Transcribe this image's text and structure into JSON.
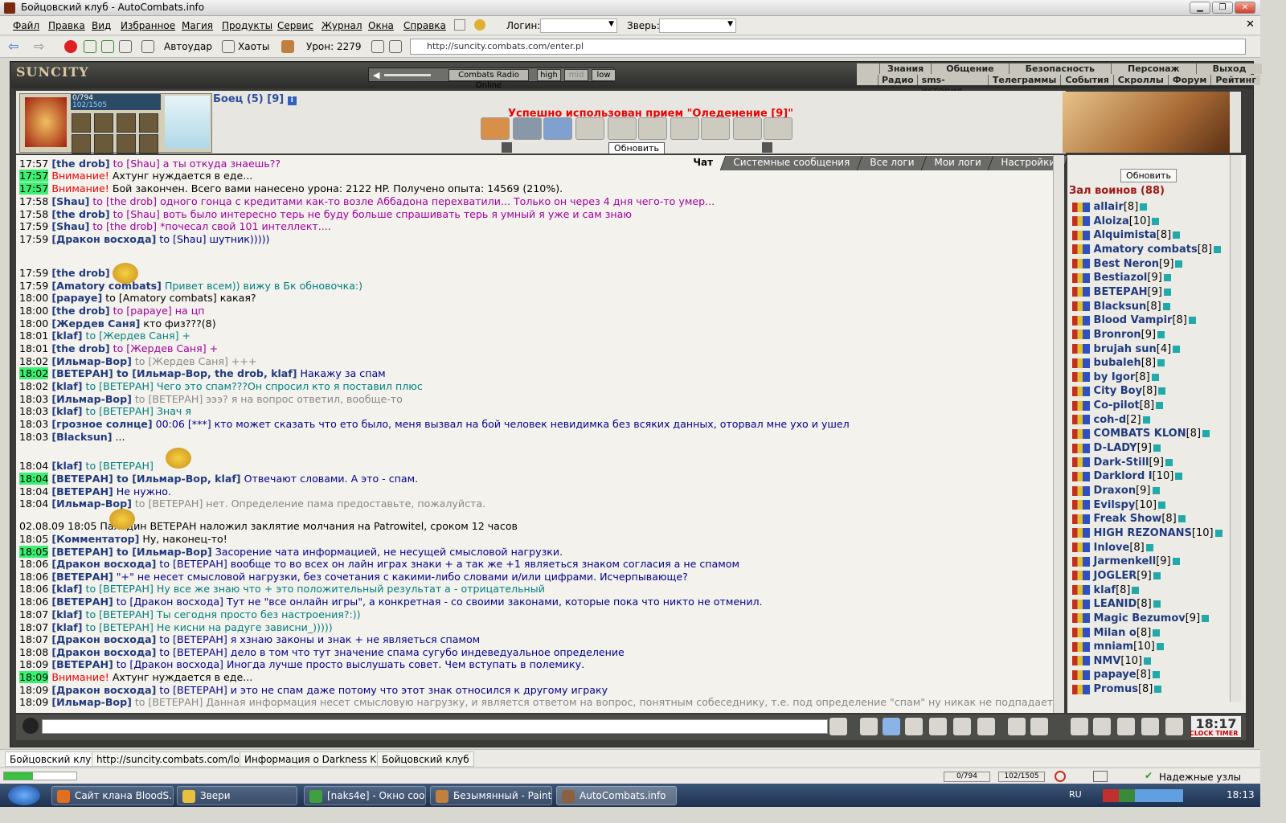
{
  "window": {
    "title": "Бойцовский клуб - AutoCombats.info"
  },
  "menu": [
    "Файл",
    "Правка",
    "Вид",
    "Избранное",
    "Магия",
    "Продукты",
    "Сервис",
    "Журнал",
    "Окна",
    "Справка"
  ],
  "login_label": "Логин:",
  "beast_label": "Зверь:",
  "toolbar": {
    "autoattack": "Автоудар",
    "chaos": "Хаоты",
    "damage": "Урон: 2279",
    "address": "http://suncity.combats.com/enter.pl"
  },
  "game": {
    "logo": "SUNCITY",
    "radio": {
      "station": "Combats Radio Online",
      "high": "high",
      "mid": "mid",
      "low": "low"
    },
    "nav_top": [
      "Знания",
      "Общение",
      "Безопасность",
      "Персонаж",
      "Выход"
    ],
    "nav_bottom": [
      "Радио",
      "sms-история",
      "Телеграммы",
      "События",
      "Скроллы",
      "Форум",
      "Рейтинг"
    ],
    "hp": "0/794",
    "mana": "102/1505",
    "fighter": "Боец (5) [9]",
    "message": "Успешно использован прием \"Оледенение [9]\"",
    "refresh": "Обновить"
  },
  "chat_tabs": [
    "Чат",
    "Системные сообщения",
    "Все логи",
    "Мои логи",
    "Настройки"
  ],
  "chat": [
    {
      "t": "17:57",
      "h": false,
      "n": "[the drob]",
      "to": " to [Shau]",
      "tc": "to",
      "m": " а ты откуда знаешь??",
      "mc": "to"
    },
    {
      "t": "17:57",
      "h": true,
      "n": "",
      "to": "Внимание!",
      "tc": "red",
      "m": " Ахтунг нуждается в еде...",
      "mc": "tm"
    },
    {
      "t": "17:57",
      "h": true,
      "n": "",
      "to": "Внимание!",
      "tc": "red",
      "m": " Бой закончен. Всего вами нанесено урона: 2122 HP. Получено опыта: 14569 (210%).",
      "mc": "tm"
    },
    {
      "t": "17:58",
      "h": false,
      "n": "[Shau]",
      "to": " to [the drob]",
      "tc": "to",
      "m": " одного гонца с кредитами как-то возле Аббадона перехватили... Только он через 4 дня чего-то умер...",
      "mc": "to"
    },
    {
      "t": "17:58",
      "h": false,
      "n": "[the drob]",
      "to": " to [Shau]",
      "tc": "to",
      "m": " воть было интересно терь не буду больше спрашивать терь я умный я уже и сам знаю",
      "mc": "to"
    },
    {
      "t": "17:59",
      "h": false,
      "n": "[Shau]",
      "to": " to [the drob]",
      "tc": "to",
      "m": " *почесал свой 101 интеллект....",
      "mc": "to"
    },
    {
      "t": "17:59",
      "h": false,
      "n": "[Дракон восхода]",
      "to": " to [Shau]",
      "tc": "tob",
      "m": " шутник)))))",
      "mc": "tob"
    },
    {
      "t": "17:59",
      "h": false,
      "n": "[the drob]",
      "to": "",
      "tc": "to",
      "m": "",
      "mc": "to"
    },
    {
      "t": "17:59",
      "h": false,
      "n": "[Amatory combats]",
      "to": "",
      "tc": "tot",
      "m": " Привет всем)) вижу в Бк обновочка:)",
      "mc": "tot"
    },
    {
      "t": "18:00",
      "h": false,
      "n": "[papaye]",
      "to": " to [Amatory combats]",
      "tc": "tm",
      "m": " какая?",
      "mc": "tm"
    },
    {
      "t": "18:00",
      "h": false,
      "n": "[the drob]",
      "to": " to [papaye]",
      "tc": "to",
      "m": " на цп",
      "mc": "to"
    },
    {
      "t": "18:00",
      "h": false,
      "n": "[Жердев Саня]",
      "to": "",
      "tc": "tm",
      "m": " кто физ???(8)",
      "mc": "tm"
    },
    {
      "t": "18:01",
      "h": false,
      "n": "[klaf]",
      "to": " to [Жердев Саня]",
      "tc": "tot",
      "m": " +",
      "mc": "tot"
    },
    {
      "t": "18:01",
      "h": false,
      "n": "[the drob]",
      "to": " to [Жердев Саня]",
      "tc": "to",
      "m": " +",
      "mc": "to"
    },
    {
      "t": "18:02",
      "h": false,
      "n": "[Ильмар-Вор]",
      "to": " to [Жердев Саня]",
      "tc": "tog",
      "m": " +++",
      "mc": "tog"
    },
    {
      "t": "18:02",
      "h": true,
      "n": "[ВЕТЕРАН]",
      "to": " to [Ильмар-Вор, the drob, klaf]",
      "tc": "nk",
      "m": " Накажу за спам",
      "mc": "tob"
    },
    {
      "t": "18:02",
      "h": false,
      "n": "[klaf]",
      "to": " to [ВЕТЕРАН]",
      "tc": "tot",
      "m": " Чего это спам???Он спросил кто я поставил плюс",
      "mc": "tot"
    },
    {
      "t": "18:03",
      "h": false,
      "n": "[Ильмар-Вор]",
      "to": " to [ВЕТЕРАН]",
      "tc": "tog",
      "m": " эээ? я на вопрос ответил, вообще-то",
      "mc": "tog"
    },
    {
      "t": "18:03",
      "h": false,
      "n": "[klaf]",
      "to": " to [ВЕТЕРАН]",
      "tc": "tot",
      "m": " Знач я",
      "mc": "tot"
    },
    {
      "t": "18:03",
      "h": false,
      "n": "[грозное солнце]",
      "to": " 00:06 [***]",
      "tc": "tob",
      "m": " кто может сказать что ето было, меня вызвал на бой человек невидимка без всяких данных, оторвал мне ухо и ушел",
      "mc": "tob"
    },
    {
      "t": "18:03",
      "h": false,
      "n": "[Blacksun]",
      "to": "",
      "tc": "tm",
      "m": " ...",
      "mc": "tm"
    },
    {
      "t": "18:04",
      "h": false,
      "n": "[klaf]",
      "to": " to [ВЕТЕРАН]",
      "tc": "tot",
      "m": "",
      "mc": "tot"
    },
    {
      "t": "18:04",
      "h": true,
      "n": "[ВЕТЕРАН]",
      "to": " to [Ильмар-Вор, klaf]",
      "tc": "nk",
      "m": " Отвечают словами. А это - спам.",
      "mc": "tob"
    },
    {
      "t": "18:04",
      "h": false,
      "n": "[ВЕТЕРАН]",
      "to": "",
      "tc": "tob",
      "m": " Не нужно.",
      "mc": "tob"
    },
    {
      "t": "18:04",
      "h": false,
      "n": "[Ильмар-Вор]",
      "to": " to [ВЕТЕРАН]",
      "tc": "tog",
      "m": " нет. Определение пама предоставьте, пожалуйста.",
      "mc": "tog"
    },
    {
      "t": "02.08.09 18:05",
      "h": false,
      "n": "",
      "to": "",
      "tc": "tm",
      "m": "Паладин ВЕТЕРАН наложил заклятие молчания на Patrowitel, сроком 12 часов",
      "mc": "tm"
    },
    {
      "t": "18:05",
      "h": false,
      "n": "[Комментатор]",
      "to": "",
      "tc": "tm",
      "m": " Ну, наконец-то!",
      "mc": "tm"
    },
    {
      "t": "18:05",
      "h": true,
      "n": "[ВЕТЕРАН]",
      "to": " to [Ильмар-Вор]",
      "tc": "nk",
      "m": " Засорение чата информацией, не несущей смысловой нагрузки.",
      "mc": "tob"
    },
    {
      "t": "18:06",
      "h": false,
      "n": "[Дракон восхода]",
      "to": " to [ВЕТЕРАН]",
      "tc": "tob",
      "m": " вообще то во всех он лайн играх знаки + а так же +1 являеться знаком согласия а не спамом",
      "mc": "tob"
    },
    {
      "t": "18:06",
      "h": false,
      "n": "[ВЕТЕРАН]",
      "to": "",
      "tc": "tob",
      "m": " \"+\" не несет смысловой нагрузки, без сочетания с какими-либо словами и/или цифрами. Исчерпывающе?",
      "mc": "tob"
    },
    {
      "t": "18:06",
      "h": false,
      "n": "[klaf]",
      "to": " to [ВЕТЕРАН]",
      "tc": "tot",
      "m": " Ну все же знаю что + это положительный результат а - отрицательный",
      "mc": "tot"
    },
    {
      "t": "18:06",
      "h": false,
      "n": "[ВЕТЕРАН]",
      "to": " to [Дракон восхода]",
      "tc": "tob",
      "m": " Тут не \"все онлайн игры\", а конкретная - со своими законами, которые пока что никто не отменил.",
      "mc": "tob"
    },
    {
      "t": "18:07",
      "h": false,
      "n": "[klaf]",
      "to": " to [ВЕТЕРАН]",
      "tc": "tot",
      "m": " Ты сегодня просто без настроения?:))",
      "mc": "tot"
    },
    {
      "t": "18:07",
      "h": false,
      "n": "[klaf]",
      "to": " to [ВЕТЕРАН]",
      "tc": "tot",
      "m": " Не кисни на радуге зависни_)))))",
      "mc": "tot"
    },
    {
      "t": "18:07",
      "h": false,
      "n": "[Дракон восхода]",
      "to": " to [ВЕТЕРАН]",
      "tc": "tob",
      "m": " я хзнаю законы и знак + не являеться спамом",
      "mc": "tob"
    },
    {
      "t": "18:08",
      "h": false,
      "n": "[Дракон восхода]",
      "to": " to [ВЕТЕРАН]",
      "tc": "tob",
      "m": " дело в том что тут значение спама сугубо индеведуальное определение",
      "mc": "tob"
    },
    {
      "t": "18:09",
      "h": false,
      "n": "[ВЕТЕРАН]",
      "to": " to [Дракон восхода]",
      "tc": "tob",
      "m": " Иногда лучше просто выслушать совет. Чем вступать в полемику.",
      "mc": "tob"
    },
    {
      "t": "18:09",
      "h": true,
      "n": "",
      "to": "Внимание!",
      "tc": "red",
      "m": " Ахтунг нуждается в еде...",
      "mc": "tm"
    },
    {
      "t": "18:09",
      "h": false,
      "n": "[Дракон восхода]",
      "to": " to [ВЕТЕРАН]",
      "tc": "tob",
      "m": " и это не спам даже потому что этот знак относился к другому играку",
      "mc": "tob"
    },
    {
      "t": "18:09",
      "h": false,
      "n": "[Ильмар-Вор]",
      "to": " to [ВЕТЕРАН]",
      "tc": "tog",
      "m": " Данная информация несет смысловую нагрузку, и является ответом на вопрос, понятным собеседнику, т.е. под определение \"спам\" ну никак не подпадает.",
      "mc": "tog"
    }
  ],
  "side": {
    "refresh": "Обновить",
    "hall_title": "Зал воинов (88)",
    "players": [
      {
        "n": "allair",
        "l": "[8]"
      },
      {
        "n": "Aloiza",
        "l": "[10]"
      },
      {
        "n": "Alquimista",
        "l": "[8]"
      },
      {
        "n": "Amatory combats",
        "l": "[8]"
      },
      {
        "n": "Best Neron",
        "l": "[9]"
      },
      {
        "n": "Bestiazol",
        "l": "[9]"
      },
      {
        "n": "ВЕТЕРАН",
        "l": "[9]"
      },
      {
        "n": "Blacksun",
        "l": "[8]"
      },
      {
        "n": "Blood Vampir",
        "l": "[8]"
      },
      {
        "n": "Bronron",
        "l": "[9]"
      },
      {
        "n": "brujah sun",
        "l": "[4]"
      },
      {
        "n": "bubaleh",
        "l": "[8]"
      },
      {
        "n": "by Igor",
        "l": "[8]"
      },
      {
        "n": "City Boy",
        "l": "[8]"
      },
      {
        "n": "Co-pilot",
        "l": "[8]"
      },
      {
        "n": "coh-d",
        "l": "[2]"
      },
      {
        "n": "COMBATS KLON",
        "l": "[8]"
      },
      {
        "n": "D-LADY",
        "l": "[9]"
      },
      {
        "n": "Dark-Still",
        "l": "[9]"
      },
      {
        "n": "Darklord I",
        "l": "[10]"
      },
      {
        "n": "Draxon",
        "l": "[9]"
      },
      {
        "n": "Evilspy",
        "l": "[10]"
      },
      {
        "n": "Freak Show",
        "l": "[8]"
      },
      {
        "n": "HIGH REZONANS",
        "l": "[10]"
      },
      {
        "n": "Inlove",
        "l": "[8]"
      },
      {
        "n": "Jarmenkell",
        "l": "[9]"
      },
      {
        "n": "JOGLER",
        "l": "[9]"
      },
      {
        "n": "klaf",
        "l": "[8]"
      },
      {
        "n": "LEANID",
        "l": "[8]"
      },
      {
        "n": "Magic Bezumov",
        "l": "[9]"
      },
      {
        "n": "Milan o",
        "l": "[8]"
      },
      {
        "n": "mniam",
        "l": "[10]"
      },
      {
        "n": "NMV",
        "l": "[10]"
      },
      {
        "n": "papaye",
        "l": "[8]"
      },
      {
        "n": "Promus",
        "l": "[8]"
      }
    ]
  },
  "clock": {
    "time": "18:17",
    "labels": "CLOCK TIMER"
  },
  "ie_tabs": [
    "Бойцовский клуб",
    "http://suncity.combats.com/lo...",
    "Информация о Darkness King",
    "Бойцовский клуб"
  ],
  "status": {
    "hp": "0/794",
    "mana": "102/1505",
    "trusted": "Надежные узлы"
  },
  "taskbar": {
    "items": [
      "Сайт клана BloodS...",
      "Звери",
      "[naks4e] - Окно соо...",
      "Безымянный - Paint",
      "AutoCombats.info"
    ],
    "lang": "RU",
    "time": "18:13"
  }
}
